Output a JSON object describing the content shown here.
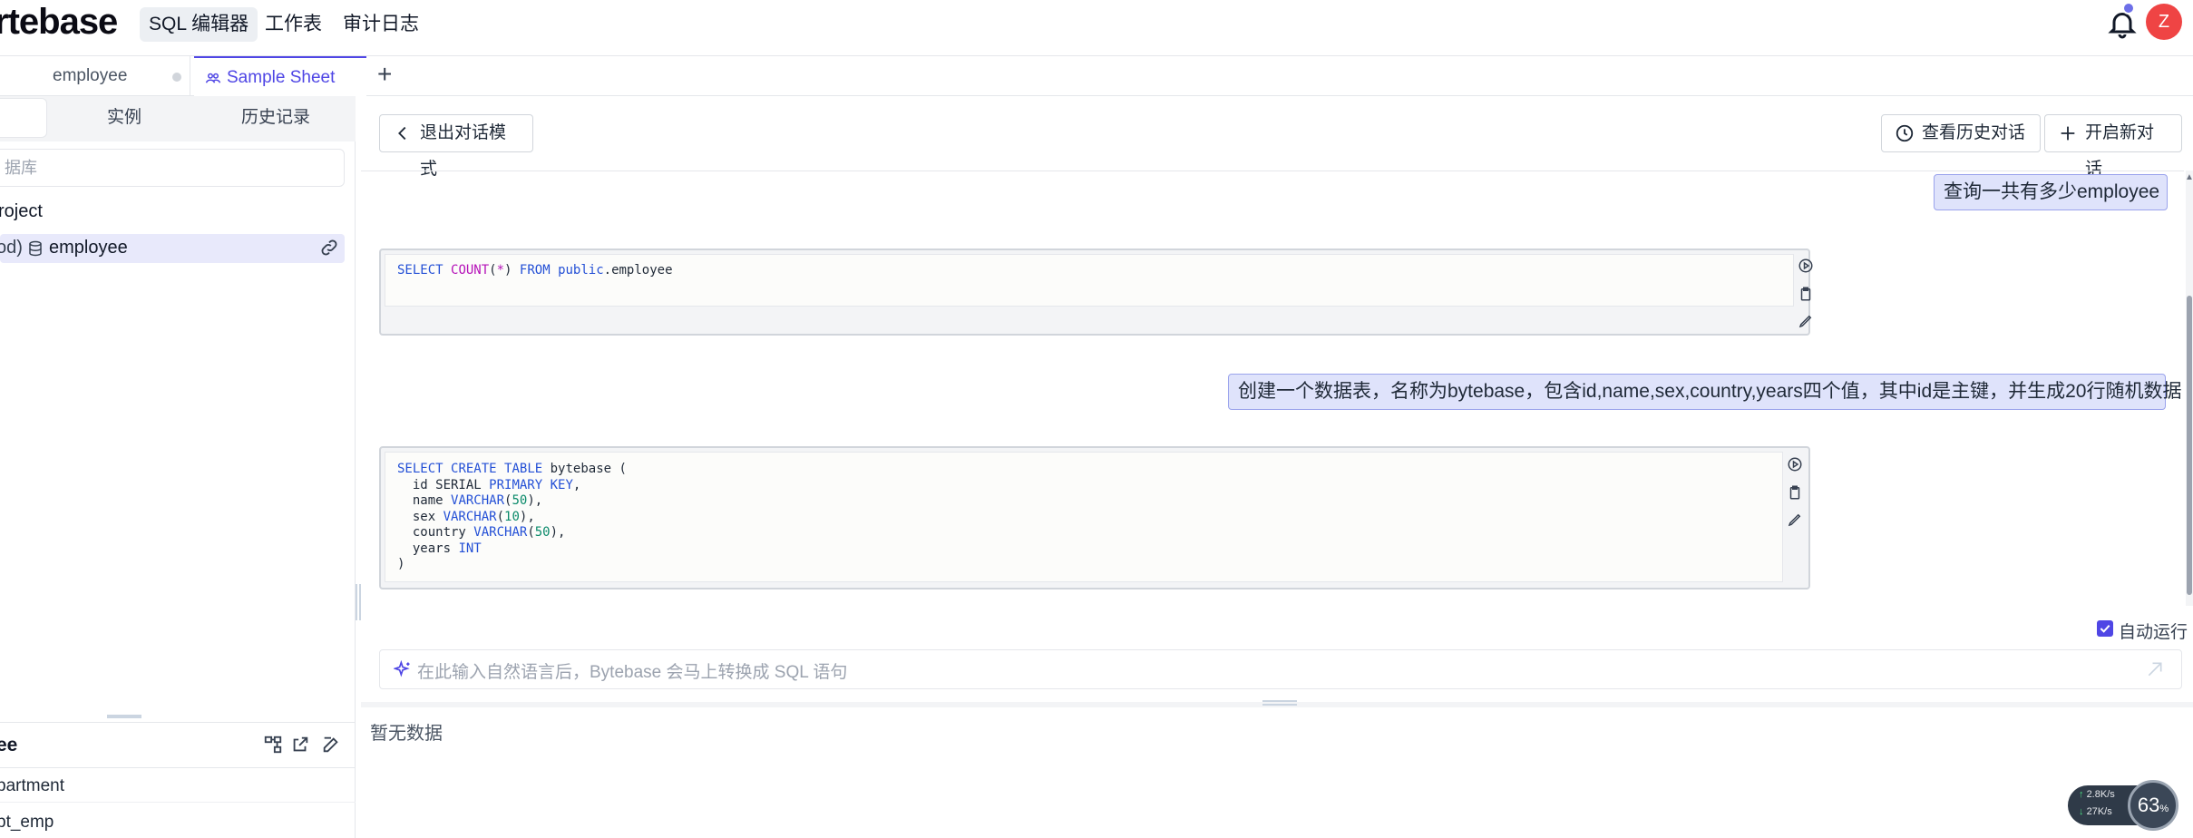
{
  "app": {
    "logo_text": "rtebase",
    "nav": [
      "SQL 编辑器",
      "工作表",
      "审计日志"
    ],
    "avatar_initial": "Z"
  },
  "tabs": {
    "items": [
      "employee",
      "Sample Sheet"
    ],
    "add_label": "+"
  },
  "left_panel": {
    "tabs": [
      "实例",
      "历史记录"
    ],
    "search_placeholder": "据库",
    "project_label": "roject",
    "db_prefix": "od)",
    "db_name": "employee",
    "bottom_title": "ee",
    "tables": [
      "partment",
      "pt_emp"
    ]
  },
  "main": {
    "exit_button": "退出对话模式",
    "history_button": "查看历史对话",
    "new_button": "开启新对话",
    "messages": [
      "查询一共有多少employee",
      "创建一个数据表，名称为bytebase，包含id,name,sex,country,years四个值，其中id是主键，并生成20行随机数据"
    ],
    "autorun_label": "自动运行",
    "nl_placeholder": "在此输入自然语言后，Bytebase 会马上转换成 SQL 语句",
    "no_data": "暂无数据"
  },
  "net_widget": {
    "up": "2.8",
    "down": "27",
    "unit": "K/s",
    "percent": "63",
    "percent_unit": "%"
  },
  "colors": {
    "accent": "#4f46e5",
    "bubble_bg": "#dfe3fb",
    "bubble_border": "#9aa3ec",
    "avatar": "#ef4444",
    "keyword": "#2450d6",
    "function": "#b512b8",
    "number": "#0a8a6a"
  }
}
